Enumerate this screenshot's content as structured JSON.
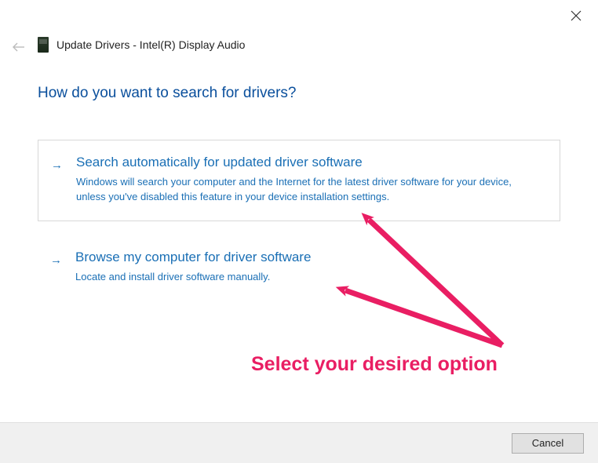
{
  "header": {
    "title": "Update Drivers - Intel(R) Display Audio"
  },
  "question": "How do you want to search for drivers?",
  "options": [
    {
      "title": "Search automatically for updated driver software",
      "desc": "Windows will search your computer and the Internet for the latest driver software for your device, unless you've disabled this feature in your device installation settings."
    },
    {
      "title": "Browse my computer for driver software",
      "desc": "Locate and install driver software manually."
    }
  ],
  "buttons": {
    "cancel": "Cancel"
  },
  "annotation": {
    "text": "Select your desired option"
  }
}
